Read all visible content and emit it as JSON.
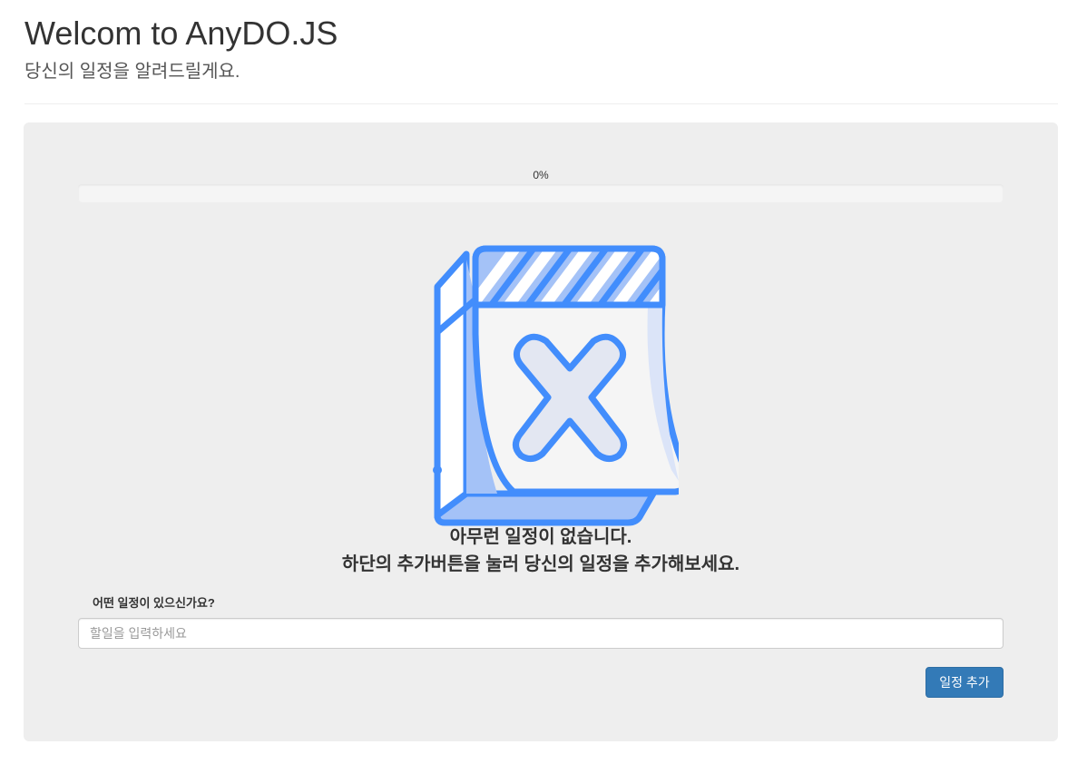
{
  "header": {
    "title": "Welcom to AnyDO.JS",
    "subtitle": "당신의 일정을 알려드릴게요."
  },
  "progress": {
    "label": "0%",
    "value": 0
  },
  "empty_state": {
    "icon": "calendar-x-icon",
    "line1": "아무런 일정이 없습니다.",
    "line2": "하단의 추가버튼을 눌러 당신의 일정을 추가해보세요."
  },
  "form": {
    "label": "어떤 일정이 있으신가요?",
    "placeholder": "할일을 입력하세요",
    "value": "",
    "button_label": "일정 추가"
  },
  "colors": {
    "primary": "#337ab7",
    "icon_blue": "#428dfc",
    "panel_bg": "#eeeeee"
  }
}
